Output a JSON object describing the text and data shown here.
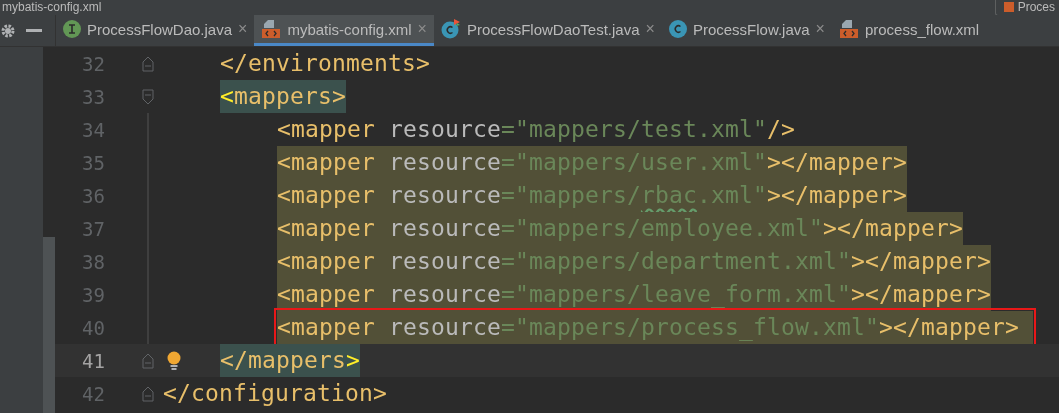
{
  "window": {
    "title": "mybatis-config.xml",
    "run_config": "Proces"
  },
  "tabs": [
    {
      "label": "ProcessFlowDao.java",
      "kind": "interface",
      "selected": false,
      "close": "×"
    },
    {
      "label": "mybatis-config.xml",
      "kind": "xml",
      "selected": true,
      "close": "×"
    },
    {
      "label": "ProcessFlowDaoTest.java",
      "kind": "test",
      "selected": false,
      "close": "×"
    },
    {
      "label": "ProcessFlow.java",
      "kind": "class",
      "selected": false,
      "close": "×"
    },
    {
      "label": "process_flow.xml",
      "kind": "xml",
      "selected": false
    }
  ],
  "lines": [
    {
      "number": "32",
      "highlighted": false,
      "tag_match": false,
      "current": false,
      "boxed": false,
      "fold_start": false,
      "fold_end": true,
      "bulb": false,
      "segments": [
        {
          "kind": "tag",
          "text": "</environments>"
        }
      ]
    },
    {
      "number": "33",
      "highlighted": false,
      "tag_match": true,
      "current": false,
      "boxed": false,
      "fold_start": true,
      "fold_end": false,
      "bulb": false,
      "segments": [
        {
          "kind": "match",
          "text": "<"
        },
        {
          "kind": "tag",
          "text": "mappers>"
        }
      ],
      "children": [
        {
          "number": "34",
          "highlighted": false,
          "tag_match": false,
          "current": false,
          "boxed": false,
          "fold_start": false,
          "fold_end": false,
          "bulb": false,
          "segments": [
            {
              "kind": "tag",
              "text": "<mapper "
            },
            {
              "kind": "attr",
              "text": "resource"
            },
            {
              "kind": "eq",
              "text": "="
            },
            {
              "kind": "value",
              "text": "\"mappers/test.xml\""
            },
            {
              "kind": "tag",
              "text": "/>"
            }
          ]
        },
        {
          "number": "35",
          "highlighted": true,
          "tag_match": false,
          "current": false,
          "boxed": false,
          "fold_start": false,
          "fold_end": false,
          "bulb": false,
          "segments": [
            {
              "kind": "tag",
              "text": "<mapper "
            },
            {
              "kind": "attr",
              "text": "resource"
            },
            {
              "kind": "eq",
              "text": "="
            },
            {
              "kind": "value",
              "text": "\"mappers/user.xml\""
            },
            {
              "kind": "tag",
              "text": "></mapper>"
            }
          ]
        },
        {
          "number": "36",
          "highlighted": true,
          "tag_match": false,
          "current": false,
          "boxed": false,
          "fold_start": false,
          "fold_end": false,
          "bulb": false,
          "segments": [
            {
              "kind": "tag",
              "text": "<mapper "
            },
            {
              "kind": "attr",
              "text": "resource"
            },
            {
              "kind": "eq",
              "text": "="
            },
            {
              "kind": "value",
              "text": "\"mappers/"
            },
            {
              "kind": "typo",
              "text": "rbac"
            },
            {
              "kind": "value",
              "text": ".xml\""
            },
            {
              "kind": "tag",
              "text": "></mapper>"
            }
          ]
        },
        {
          "number": "37",
          "highlighted": true,
          "tag_match": false,
          "current": false,
          "boxed": false,
          "fold_start": false,
          "fold_end": false,
          "bulb": false,
          "segments": [
            {
              "kind": "tag",
              "text": "<mapper "
            },
            {
              "kind": "attr",
              "text": "resource"
            },
            {
              "kind": "eq",
              "text": "="
            },
            {
              "kind": "value",
              "text": "\"mappers/employee.xml\""
            },
            {
              "kind": "tag",
              "text": "></mapper>"
            }
          ]
        },
        {
          "number": "38",
          "highlighted": true,
          "tag_match": false,
          "current": false,
          "boxed": false,
          "fold_start": false,
          "fold_end": false,
          "bulb": false,
          "segments": [
            {
              "kind": "tag",
              "text": "<mapper "
            },
            {
              "kind": "attr",
              "text": "resource"
            },
            {
              "kind": "eq",
              "text": "="
            },
            {
              "kind": "value",
              "text": "\"mappers/department.xml\""
            },
            {
              "kind": "tag",
              "text": "></mapper>"
            }
          ]
        },
        {
          "number": "39",
          "highlighted": true,
          "tag_match": false,
          "current": false,
          "boxed": false,
          "fold_start": false,
          "fold_end": false,
          "bulb": false,
          "segments": [
            {
              "kind": "tag",
              "text": "<mapper "
            },
            {
              "kind": "attr",
              "text": "resource"
            },
            {
              "kind": "eq",
              "text": "="
            },
            {
              "kind": "value",
              "text": "\"mappers/leave_form.xml\""
            },
            {
              "kind": "tag",
              "text": "></mapper>"
            }
          ]
        },
        {
          "number": "40",
          "highlighted": true,
          "tag_match": false,
          "current": false,
          "boxed": true,
          "fold_start": false,
          "fold_end": false,
          "bulb": false,
          "segments": [
            {
              "kind": "tag",
              "text": "<mapper "
            },
            {
              "kind": "attr",
              "text": "resource"
            },
            {
              "kind": "eq",
              "text": "="
            },
            {
              "kind": "value",
              "text": "\"mappers/process_flow.xml\""
            },
            {
              "kind": "tag",
              "text": "></mapper>"
            }
          ]
        }
      ]
    },
    {
      "number": "41",
      "highlighted": false,
      "tag_match": true,
      "current": true,
      "boxed": false,
      "fold_start": false,
      "fold_end": true,
      "bulb": true,
      "segments": [
        {
          "kind": "tag",
          "text": "</mappers"
        },
        {
          "kind": "match",
          "text": ">"
        }
      ]
    }
  ],
  "closing_lines": [
    {
      "number": "42",
      "highlighted": false,
      "tag_match": false,
      "current": false,
      "boxed": false,
      "fold_start": false,
      "fold_end": true,
      "bulb": false,
      "segments": [
        {
          "kind": "tag",
          "text": "</configuration>"
        }
      ]
    }
  ]
}
